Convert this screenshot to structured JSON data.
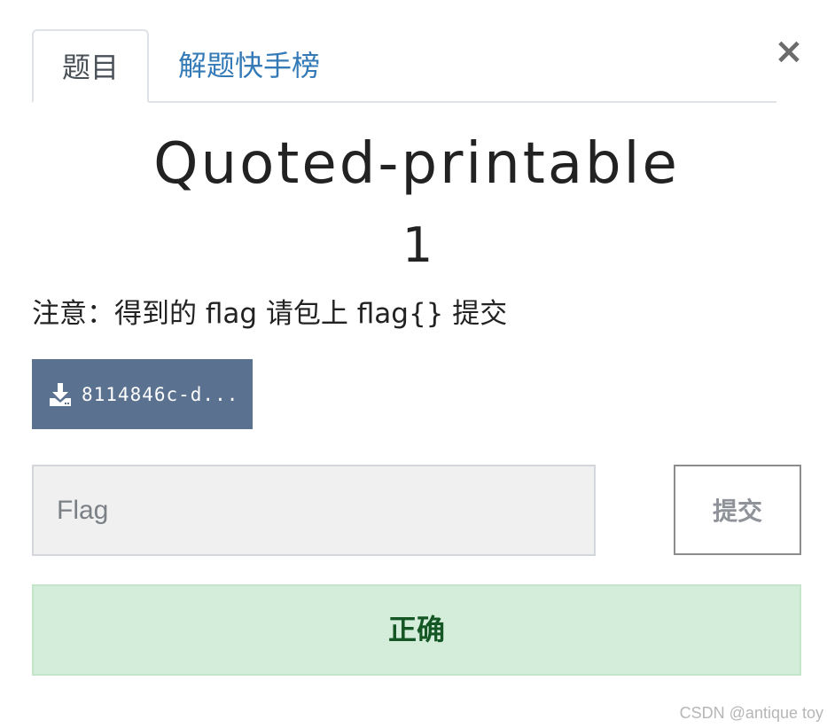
{
  "tabs": [
    {
      "label": "题目",
      "active": true
    },
    {
      "label": "解题快手榜",
      "active": false
    }
  ],
  "close_label": "×",
  "challenge": {
    "title": "Quoted-printable",
    "points": "1",
    "notice": "注意：得到的 flag 请包上 flag{} 提交"
  },
  "download": {
    "label": "8114846c-d...",
    "icon": "download-icon"
  },
  "flag_form": {
    "placeholder": "Flag",
    "value": "",
    "submit_label": "提交"
  },
  "result": {
    "message": "正确"
  },
  "watermark": "CSDN @antique toy",
  "colors": {
    "tab_link": "#337ab7",
    "download_bg": "#5b7190",
    "success_bg": "#d4edda",
    "success_text": "#155724"
  }
}
